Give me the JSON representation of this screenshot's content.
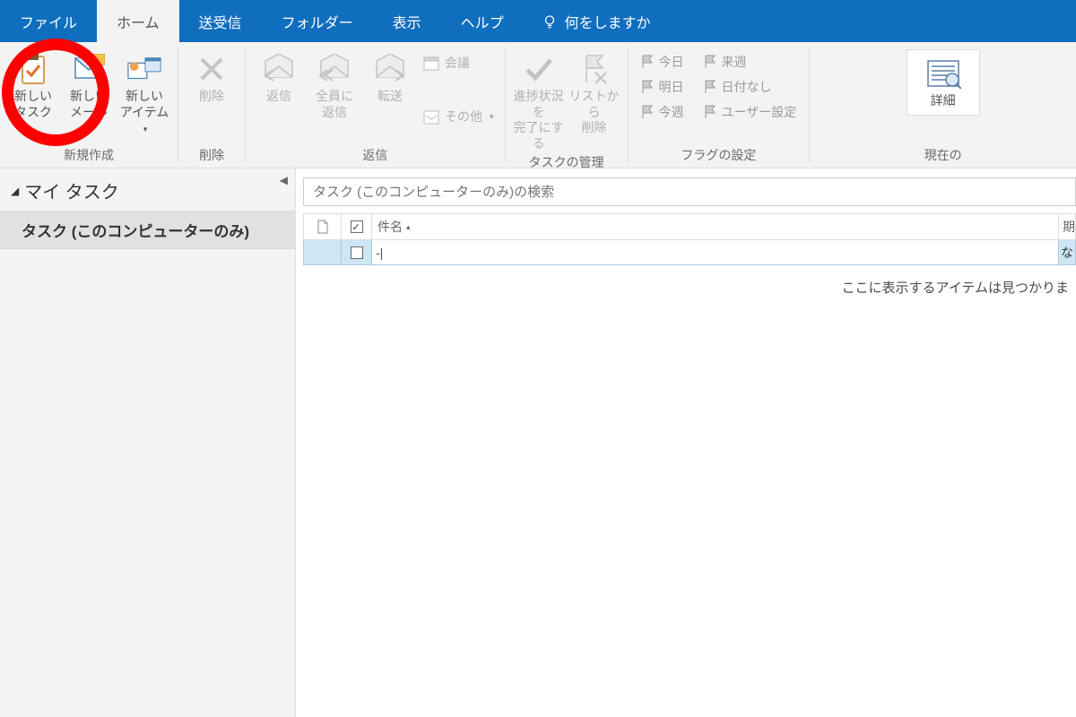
{
  "tabs": {
    "file": "ファイル",
    "home": "ホーム",
    "sendreceive": "送受信",
    "folder": "フォルダー",
    "view": "表示",
    "help": "ヘルプ",
    "tellme": "何をしますか"
  },
  "ribbon": {
    "groups": {
      "new": "新規作成",
      "delete": "削除",
      "respond": "返信",
      "manage": "タスクの管理",
      "flags": "フラグの設定",
      "currentview": "現在の"
    },
    "buttons": {
      "newTask": "新しい\nタスク",
      "newMail": "新しい\nメール",
      "newItems": "新しい\nアイテム",
      "delete": "削除",
      "reply": "返信",
      "replyAll": "全員に\n返信",
      "forward": "転送",
      "meeting": "会議",
      "more": "その他",
      "markComplete": "進捗状況を\n完了にする",
      "removeList": "リストから\n削除",
      "today": "今日",
      "tomorrow": "明日",
      "thisWeek": "今週",
      "nextWeek": "来週",
      "noDate": "日付なし",
      "custom": "ユーザー設定",
      "detail": "詳細"
    }
  },
  "nav": {
    "header": "マイ タスク",
    "item": "タスク (このコンピューターのみ)"
  },
  "main": {
    "searchPlaceholder": "タスク (このコンピューターのみ)の検索",
    "colSubject": "件名",
    "colDue": "期",
    "newRowDue": "な",
    "cursor": "-|",
    "empty": "ここに表示するアイテムは見つかりま"
  }
}
